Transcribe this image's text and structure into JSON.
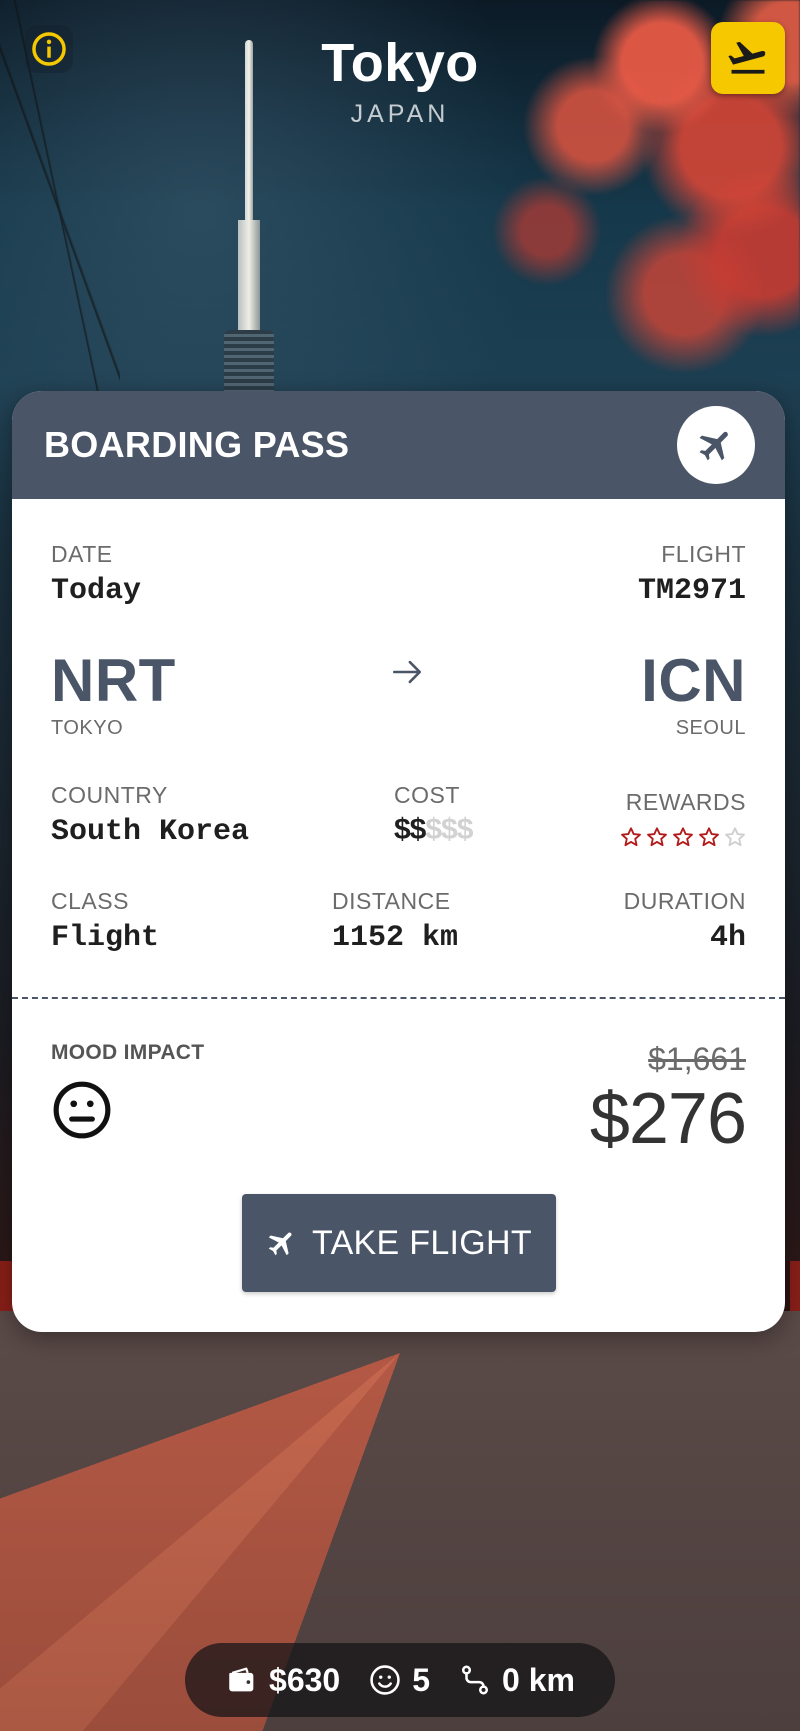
{
  "header": {
    "city": "Tokyo",
    "country": "JAPAN",
    "info_icon": "info-icon",
    "flights_icon": "departure-plane-icon"
  },
  "boarding_pass": {
    "title": "BOARDING PASS",
    "date_label": "DATE",
    "date_value": "Today",
    "flight_label": "FLIGHT",
    "flight_value": "TM2971",
    "origin_code": "NRT",
    "origin_city": "TOKYO",
    "destination_code": "ICN",
    "destination_city": "SEOUL",
    "country_label": "COUNTRY",
    "country_value": "South Korea",
    "cost_label": "COST",
    "cost_active": "$$",
    "cost_inactive": "$$$",
    "rewards_label": "REWARDS",
    "rewards_stars": 4,
    "rewards_max": 5,
    "class_label": "CLASS",
    "class_value": "Flight",
    "distance_label": "DISTANCE",
    "distance_value": "1152 km",
    "duration_label": "DURATION",
    "duration_value": "4h",
    "mood_label": "MOOD IMPACT",
    "mood_icon": "neutral-face-icon",
    "original_price": "$1,661",
    "price": "$276",
    "take_flight_label": "TAKE FLIGHT"
  },
  "status": {
    "money": "$630",
    "mood": "5",
    "distance": "0 km"
  },
  "colors": {
    "slate": "#4a5568",
    "accent_yellow": "#f5c800",
    "star_red": "#b31b1b"
  }
}
